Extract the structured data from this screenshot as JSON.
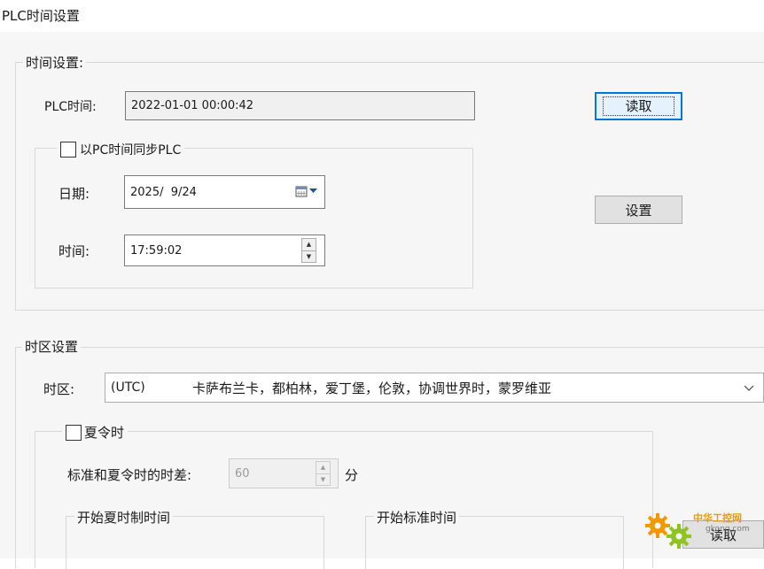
{
  "window": {
    "title": "PLC时间设置"
  },
  "time_settings": {
    "legend": "时间设置:",
    "plc_time_label": "PLC时间:",
    "plc_time_value": "2022-01-01 00:00:42",
    "read_button": "读取",
    "set_button": "设置",
    "sync": {
      "label": "以PC时间同步PLC",
      "checked": false,
      "date_label": "日期:",
      "date_value": "2025/  9/24",
      "time_label": "时间:",
      "time_value": "17:59:02"
    }
  },
  "timezone_settings": {
    "legend": "时区设置",
    "timezone_label": "时区:",
    "timezone_prefix": "(UTC)",
    "timezone_value": "卡萨布兰卡，都柏林，爱丁堡，伦敦，协调世界时，蒙罗维亚",
    "dst": {
      "label": "夏令时",
      "checked": false,
      "offset_label": "标准和夏令时的时差:",
      "offset_value": "60",
      "offset_unit": "分",
      "start_dst_legend": "开始夏时制时间",
      "start_std_legend": "开始标准时间",
      "read_button": "读取"
    }
  },
  "watermark": {
    "name": "中华工控网",
    "url": "gkong.com"
  },
  "colors": {
    "panel_bg": "#f6f6f6",
    "default_button_border": "#0078d7",
    "watermark_orange": "#f39800",
    "watermark_green": "#8fc31f"
  }
}
